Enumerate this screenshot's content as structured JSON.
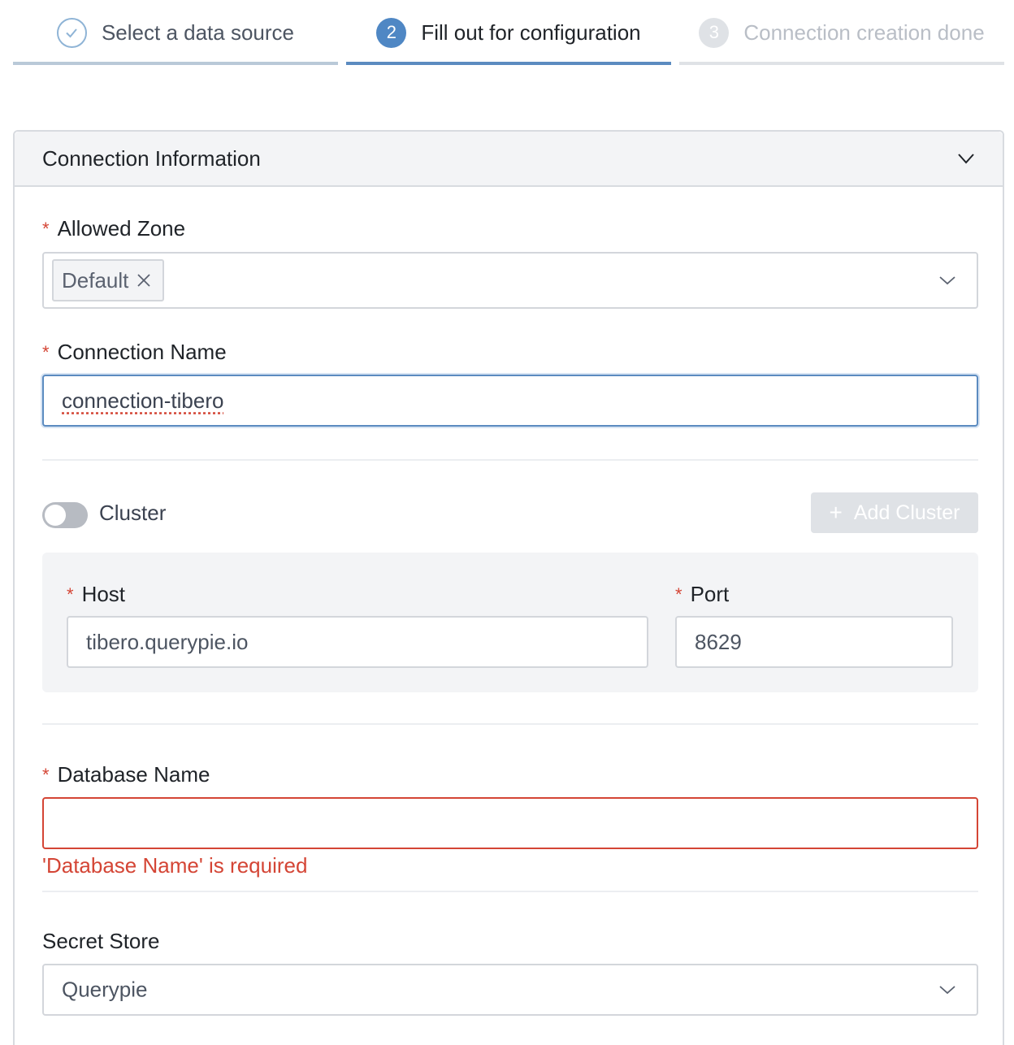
{
  "stepper": {
    "steps": [
      {
        "number": "",
        "label": "Select a data source",
        "state": "done",
        "icon": "check-icon"
      },
      {
        "number": "2",
        "label": "Fill out for configuration",
        "state": "active"
      },
      {
        "number": "3",
        "label": "Connection creation done",
        "state": "inactive"
      }
    ]
  },
  "panel": {
    "title": "Connection Information",
    "collapse_icon": "chevron-down-icon"
  },
  "form": {
    "allowed_zone": {
      "label": "Allowed Zone",
      "required_mark": "*",
      "tags": [
        "Default"
      ]
    },
    "connection_name": {
      "label": "Connection Name",
      "required_mark": "*",
      "value": "connection-tibero"
    },
    "cluster": {
      "label": "Cluster",
      "enabled": false,
      "add_button_label": "Add Cluster",
      "add_button_icon": "plus-icon"
    },
    "host": {
      "label": "Host",
      "required_mark": "*",
      "value": "tibero.querypie.io"
    },
    "port": {
      "label": "Port",
      "required_mark": "*",
      "value": "8629"
    },
    "database_name": {
      "label": "Database Name",
      "required_mark": "*",
      "value": "",
      "error": "'Database Name' is required"
    },
    "secret_store": {
      "label": "Secret Store",
      "value": "Querypie"
    }
  },
  "colors": {
    "accent": "#4f87c4",
    "error": "#d44535",
    "border": "#d3d6db"
  }
}
